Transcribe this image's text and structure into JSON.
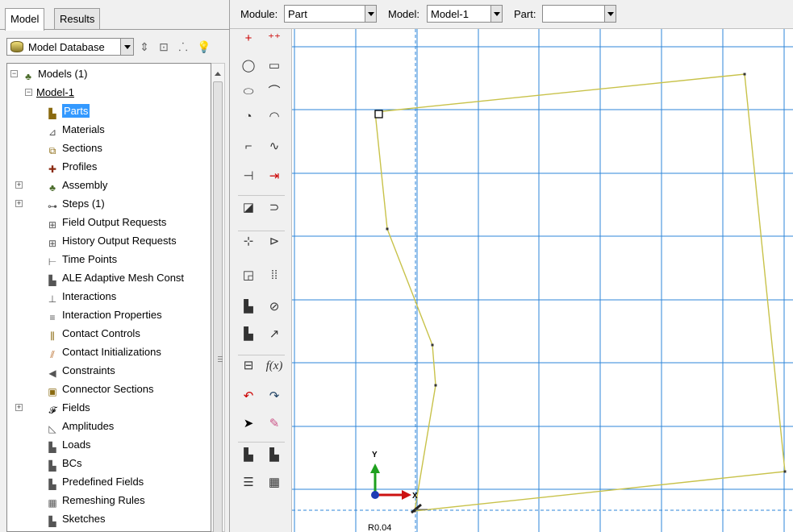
{
  "tabs": [
    {
      "label": "Model",
      "active": true
    },
    {
      "label": "Results",
      "active": false
    }
  ],
  "database": {
    "selected": "Model Database"
  },
  "tree": {
    "root": {
      "label": "Models (1)",
      "expanded": true
    },
    "model": {
      "label": "Model-1",
      "expanded": true
    },
    "items": [
      {
        "label": "Parts",
        "icon": "part-icon",
        "selected": true
      },
      {
        "label": "Materials",
        "icon": "material-icon"
      },
      {
        "label": "Sections",
        "icon": "section-icon"
      },
      {
        "label": "Profiles",
        "icon": "profile-icon"
      },
      {
        "label": "Assembly",
        "icon": "assembly-icon",
        "expandable": true
      },
      {
        "label": "Steps (1)",
        "icon": "steps-icon",
        "expandable": true
      },
      {
        "label": "Field Output Requests",
        "icon": "field-output-icon"
      },
      {
        "label": "History Output Requests",
        "icon": "history-output-icon"
      },
      {
        "label": "Time Points",
        "icon": "time-points-icon"
      },
      {
        "label": "ALE Adaptive Mesh Const",
        "icon": "ale-mesh-icon"
      },
      {
        "label": "Interactions",
        "icon": "interactions-icon"
      },
      {
        "label": "Interaction Properties",
        "icon": "interaction-properties-icon"
      },
      {
        "label": "Contact Controls",
        "icon": "contact-controls-icon"
      },
      {
        "label": "Contact Initializations",
        "icon": "contact-init-icon"
      },
      {
        "label": "Constraints",
        "icon": "constraints-icon"
      },
      {
        "label": "Connector Sections",
        "icon": "connector-sections-icon"
      },
      {
        "label": "Fields",
        "icon": "fields-icon",
        "expandable": true
      },
      {
        "label": "Amplitudes",
        "icon": "amplitudes-icon"
      },
      {
        "label": "Loads",
        "icon": "loads-icon"
      },
      {
        "label": "BCs",
        "icon": "bcs-icon"
      },
      {
        "label": "Predefined Fields",
        "icon": "predefined-fields-icon"
      },
      {
        "label": "Remeshing Rules",
        "icon": "remeshing-rules-icon"
      },
      {
        "label": "Sketches",
        "icon": "sketches-icon"
      }
    ]
  },
  "toolbar": {
    "module_label": "Module:",
    "module_value": "Part",
    "model_label": "Model:",
    "model_value": "Model-1",
    "part_label": "Part:",
    "part_value": ""
  },
  "sketch_tools": [
    "add-point-icon",
    "isolated-point-icon",
    "circle-icon",
    "rectangle-icon",
    "ellipse-icon",
    "arc-tangent-icon",
    "arc-center-icon",
    "arc-three-point-icon",
    "fillet-icon",
    "spline-icon",
    "construction-line-icon",
    "dimension-icon",
    "edit-dimension-icon",
    "offset-curve-icon",
    "split-icon",
    "trim-extend-icon",
    "linear-pattern-icon",
    "radial-pattern-icon",
    "copy-icon",
    "auto-constrain-icon",
    "translate-icon",
    "scale-icon",
    "parameter-manager-icon",
    "function-fx-icon",
    "undo-icon",
    "redo-icon",
    "select-arrow-icon",
    "eraser-icon",
    "open-sketch-icon",
    "save-sketch-icon",
    "sketch-options-icon",
    "grid-options-icon"
  ],
  "function_label": "f(x)",
  "viewport": {
    "axis_y": "Y",
    "axis_x": "X",
    "readout": "R0.04",
    "sketch_color": "#c8c24a",
    "grid_color": "#2e86d8"
  }
}
